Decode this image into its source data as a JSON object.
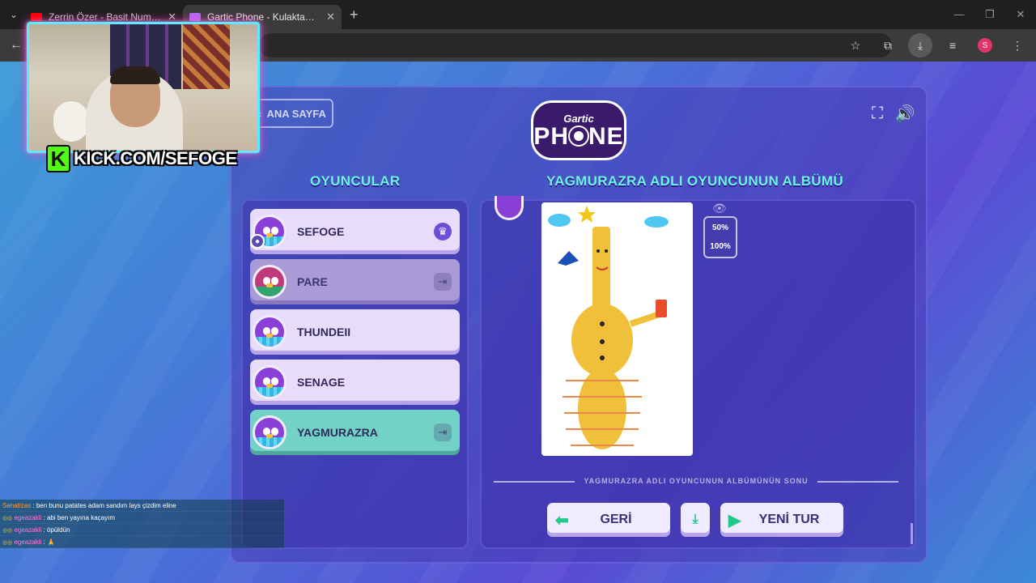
{
  "browser": {
    "tabs": [
      {
        "title": "Zerrin Özer - Basit Numaralar (",
        "favicon": "youtube-icon",
        "color": "#ff0000",
        "active": false
      },
      {
        "title": "Gartic Phone - Kulaktan Kulağa",
        "favicon": "phone-icon",
        "color": "#b36bf5",
        "active": true
      }
    ],
    "profile_initial": "S"
  },
  "stream": {
    "kick_logo": "K",
    "kick_url": "KICK.COM/SEFOGE"
  },
  "game": {
    "home_button": "ANA SAYFA",
    "logo_top": "Gartic",
    "logo_main_left": "PH",
    "logo_main_right": "NE",
    "players_heading": "OYUNCULAR",
    "album_heading": "YAGMURAZRA ADLI OYUNCUNUN ALBÜMÜ",
    "players": [
      {
        "name": "SEFOGE",
        "state": "host",
        "icon": "crown-icon"
      },
      {
        "name": "PARE",
        "state": "left",
        "icon": "exit-icon"
      },
      {
        "name": "THUNDEII",
        "state": "active",
        "icon": ""
      },
      {
        "name": "SENAGE",
        "state": "active",
        "icon": ""
      },
      {
        "name": "YAGMURAZRA",
        "state": "highlighted",
        "icon": "exit-icon"
      }
    ],
    "zoom_options": [
      "50%",
      "100%"
    ],
    "album_end_label": "YAGMURAZRA ADLI OYUNCUNUN ALBÜMÜNÜN SONU",
    "back_button": "GERİ",
    "new_round_button": "YENİ TUR",
    "colors": {
      "accent_teal": "#6cf3e4",
      "button_green": "#1fc987"
    }
  },
  "chat": [
    {
      "user": "Senatizas",
      "color": "orange",
      "message": ": ben bunu patates adam sandım lays çizdim eline",
      "badges": ""
    },
    {
      "user": "egeazakli",
      "color": "pink",
      "message": ": abi ben yayına kaçayım",
      "badges": "◎◎"
    },
    {
      "user": "egeazakli",
      "color": "pink",
      "message": ": öpüldün",
      "badges": "◎◎"
    },
    {
      "user": "egeazakli",
      "color": "pink",
      "message": ": 🙏",
      "badges": "◎◎"
    }
  ]
}
